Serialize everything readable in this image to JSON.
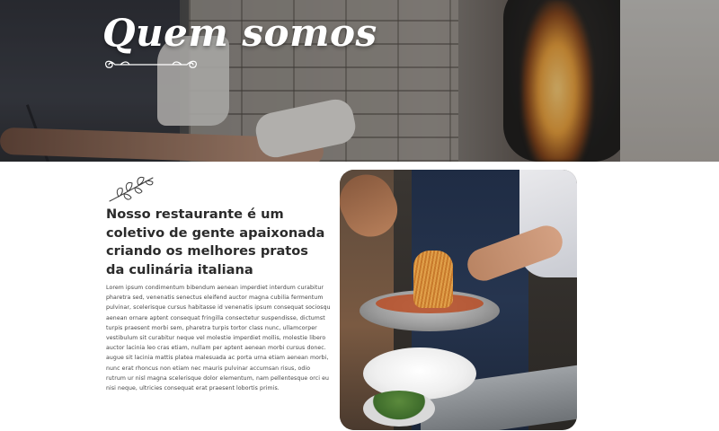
{
  "hero": {
    "title": "Quem somos"
  },
  "about": {
    "heading": "Nosso restaurante é um coletivo de gente apaixonada criando os melhores pratos da culinária italiana",
    "body": "Lorem ipsum condimentum bibendum aenean imperdiet interdum curabitur pharetra sed, venenatis senectus eleifend auctor magna cubilia fermentum pulvinar, scelerisque cursus habitasse id venenatis ipsum consequat sociosqu aenean ornare aptent consequat fringilla consectetur suspendisse, dictumst turpis praesent morbi sem, pharetra turpis tortor class nunc, ullamcorper vestibulum sit curabitur neque vel molestie imperdiet mollis, molestie libero auctor lacinia leo cras etiam, nullam per aptent aenean morbi cursus donec. augue sit lacinia mattis platea malesuada ac porta urna etiam aenean morbi, nunc erat rhoncus non etiam nec mauris pulvinar accumsan risus, odio rutrum ur nisl magna scelerisque dolor elementum, nam pellentesque orci eu nisi neque, ultricies consequat erat praesent lobortis primis."
  },
  "icons": {
    "flourish": "ornament-flourish-icon",
    "leaf": "olive-branch-icon"
  },
  "colors": {
    "heading": "#2b2b2b",
    "body": "#444444",
    "hero_text": "#ffffff"
  }
}
